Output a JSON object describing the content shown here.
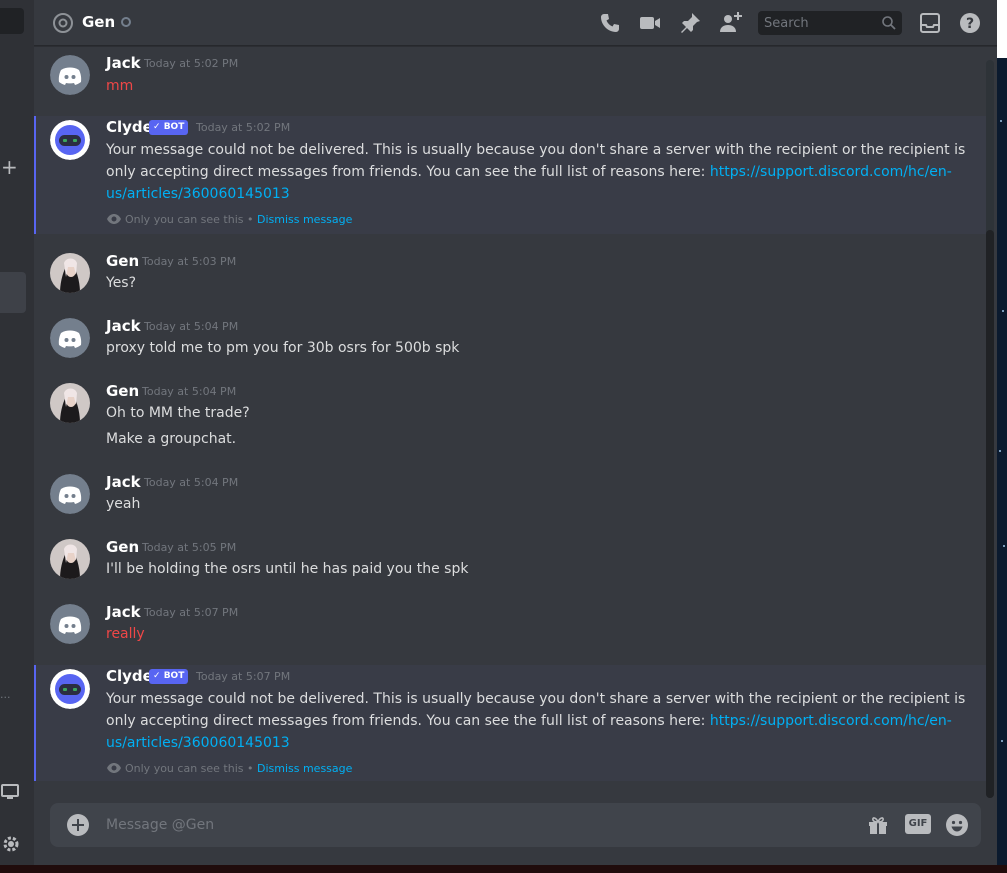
{
  "colors": {
    "background": "#36393f",
    "sidebar": "#2f3136",
    "accent": "#5865f2",
    "link": "#00b0f4",
    "red_text": "#f04747",
    "muted": "#72767d",
    "text": "#dcddde"
  },
  "header": {
    "title": "Gen",
    "icons": [
      "at-icon",
      "status-dot",
      "call-icon",
      "video-icon",
      "pin-icon",
      "add-member-icon",
      "search-icon",
      "inbox-icon",
      "help-icon"
    ],
    "search_placeholder": "Search"
  },
  "messages": [
    {
      "author": "Jack",
      "avatar": "discord-default-avatar",
      "timestamp": "Today at 5:02 PM",
      "lines": [
        "mm"
      ],
      "style": "red"
    },
    {
      "author": "Clyde",
      "avatar": "clyde-bot-avatar",
      "bot_tag": "BOT",
      "timestamp": "Today at 5:02 PM",
      "lines": [
        "Your message could not be delivered. This is usually because you don't share a server with the recipient or the recipient is",
        "only accepting direct messages from friends. You can see the full list of reasons here: "
      ],
      "link_part1": "https://support.discord.com/hc/en-",
      "link_part2": "us/articles/360060145013",
      "note": "Only you can see this",
      "separator": " • ",
      "dismiss": "Dismiss message"
    },
    {
      "author": "Gen",
      "avatar": "user-photo-avatar",
      "timestamp": "Today at 5:03 PM",
      "lines": [
        "Yes?"
      ]
    },
    {
      "author": "Jack",
      "avatar": "discord-default-avatar",
      "timestamp": "Today at 5:04 PM",
      "lines": [
        "proxy told me to pm you for 30b osrs for 500b spk"
      ]
    },
    {
      "author": "Gen",
      "avatar": "user-photo-avatar",
      "timestamp": "Today at 5:04 PM",
      "lines": [
        "Oh to MM the trade?",
        "Make a groupchat."
      ]
    },
    {
      "author": "Jack",
      "avatar": "discord-default-avatar",
      "timestamp": "Today at 5:04 PM",
      "lines": [
        "yeah"
      ]
    },
    {
      "author": "Gen",
      "avatar": "user-photo-avatar",
      "timestamp": "Today at 5:05 PM",
      "lines": [
        "I'll be holding the osrs until he has paid you the  spk"
      ]
    },
    {
      "author": "Jack",
      "avatar": "discord-default-avatar",
      "timestamp": "Today at 5:07 PM",
      "lines": [
        "really"
      ],
      "style": "red"
    },
    {
      "author": "Clyde",
      "avatar": "clyde-bot-avatar",
      "bot_tag": "BOT",
      "timestamp": "Today at 5:07 PM",
      "lines": [
        "Your message could not be delivered. This is usually because you don't share a server with the recipient or the recipient is",
        "only accepting direct messages from friends. You can see the full list of reasons here: "
      ],
      "link_part1": "https://support.discord.com/hc/en-",
      "link_part2": "us/articles/360060145013",
      "note": "Only you can see this",
      "separator": " • ",
      "dismiss": "Dismiss message"
    }
  ],
  "composer": {
    "placeholder": "Message @Gen",
    "icons": [
      "add-attachment-icon",
      "gift-icon",
      "gif-icon",
      "emoji-icon"
    ],
    "gif_label": "GIF"
  }
}
